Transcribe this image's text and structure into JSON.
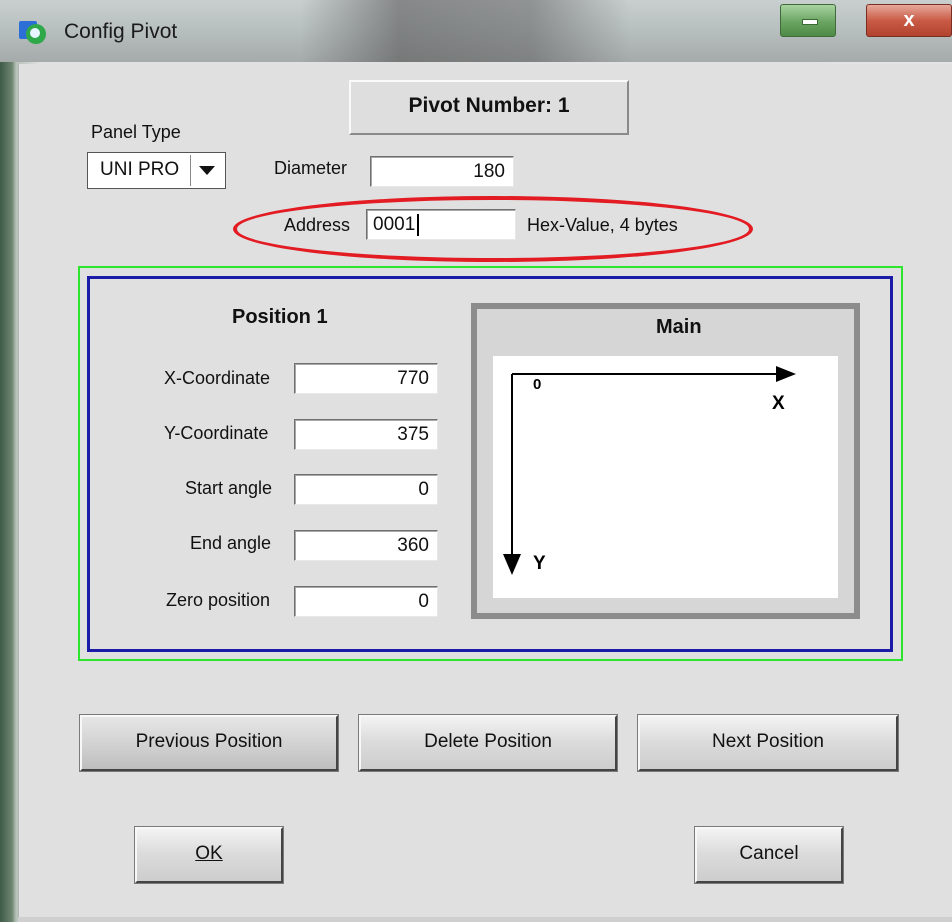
{
  "window": {
    "title": "Config Pivot",
    "close_label": "x"
  },
  "pivot_number_label": "Pivot Number: 1",
  "panel_type": {
    "label": "Panel Type",
    "selected": "UNI PRO"
  },
  "diameter": {
    "label": "Diameter",
    "value": "180"
  },
  "address": {
    "label": "Address",
    "value": "0001",
    "hint": "Hex-Value, 4 bytes"
  },
  "position": {
    "title": "Position 1",
    "fields": [
      {
        "label": "X-Coordinate",
        "value": "770"
      },
      {
        "label": "Y-Coordinate",
        "value": "375"
      },
      {
        "label": "Start angle",
        "value": "0"
      },
      {
        "label": "End angle",
        "value": "360"
      },
      {
        "label": "Zero position",
        "value": "0"
      }
    ]
  },
  "main_view": {
    "title": "Main",
    "origin_label": "0",
    "x_axis_label": "X",
    "y_axis_label": "Y"
  },
  "buttons": {
    "previous": "Previous Position",
    "delete": "Delete Position",
    "next": "Next Position",
    "ok": "OK",
    "cancel": "Cancel"
  },
  "annotation_color": "#e31b23"
}
